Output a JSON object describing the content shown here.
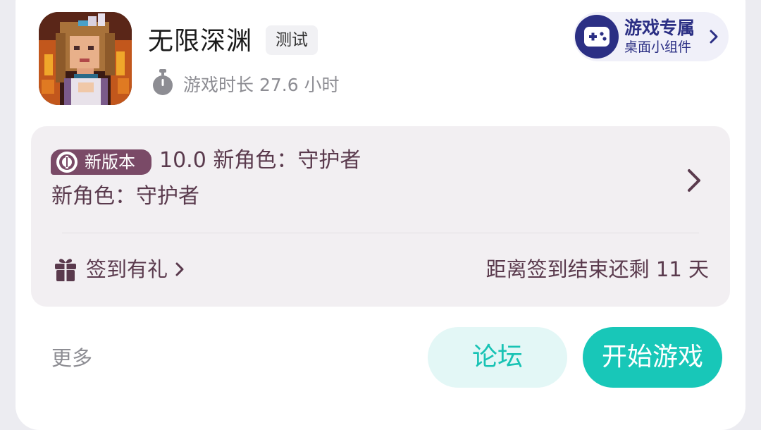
{
  "game": {
    "title": "无限深渊",
    "tag": "测试",
    "playtime": "游戏时长 27.6 小时",
    "icon": "game-character-portrait"
  },
  "widget": {
    "title": "游戏专属",
    "subtitle": "桌面小组件",
    "icon": "gamepad-icon"
  },
  "update": {
    "badge": "新版本",
    "line1": "10.0 新角色：守护者",
    "line2": "新角色：守护者"
  },
  "checkin": {
    "label": "签到有礼",
    "remaining": "距离签到结束还剩 11 天",
    "icon": "gift-icon"
  },
  "footer": {
    "more": "更多",
    "forum": "论坛",
    "play": "开始游戏"
  },
  "colors": {
    "accent": "#18c7b8",
    "brand_dark": "#2b2f84",
    "panel_text": "#5a3a4d",
    "badge_bg": "#7a4a67"
  }
}
